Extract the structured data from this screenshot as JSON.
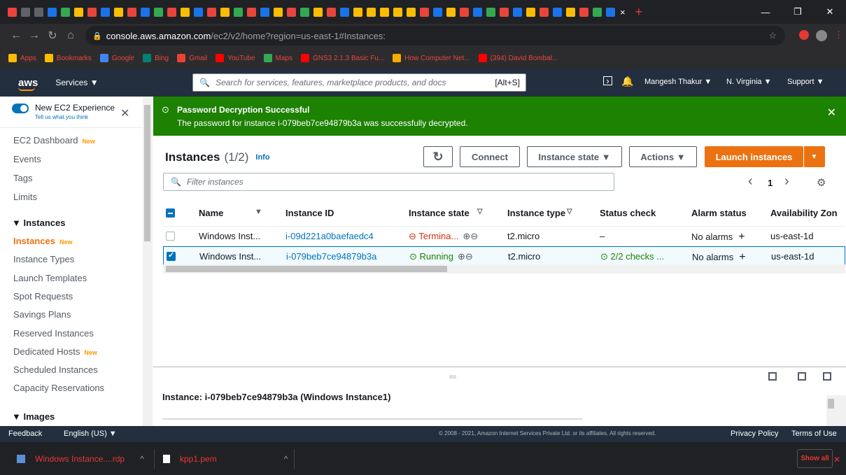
{
  "browser": {
    "tab_close": "×",
    "new_tab": "+",
    "window": {
      "minimize": "—",
      "maximize": "❐",
      "close": "✕"
    },
    "url_host": "console.aws.amazon.com",
    "url_path": "/ec2/v2/home?region=us-east-1#Instances:",
    "bookmarks": [
      {
        "label": "Apps",
        "color": "#fbbc04"
      },
      {
        "label": "Bookmarks",
        "color": "#fbbc04"
      },
      {
        "label": "Google",
        "color": "#4285f4"
      },
      {
        "label": "Bing",
        "color": "#008373"
      },
      {
        "label": "Gmail",
        "color": "#ea4335"
      },
      {
        "label": "YouTube",
        "color": "#ff0000"
      },
      {
        "label": "Maps",
        "color": "#34a853"
      },
      {
        "label": "GNS3 2.1.3 Basic Fu...",
        "color": "#ff0000"
      },
      {
        "label": "How Computer Net...",
        "color": "#f9ab00"
      },
      {
        "label": "(394) David Bombal...",
        "color": "#ff0000"
      }
    ]
  },
  "aws_nav": {
    "logo": "aws",
    "services": "Services ▼",
    "search_placeholder": "Search for services, features, marketplace products, and docs",
    "search_shortcut": "[Alt+S]",
    "user": "Mangesh Thakur ▼",
    "region": "N. Virginia ▼",
    "support": "Support ▼"
  },
  "sidebar": {
    "toggle_label": "New EC2 Experience",
    "toggle_sub": "Tell us what you think",
    "close": "✕",
    "new_badge": "New",
    "items": [
      {
        "label": "EC2 Dashboard",
        "new": true
      },
      {
        "label": "Events"
      },
      {
        "label": "Tags"
      },
      {
        "label": "Limits"
      }
    ],
    "section_instances": "▼  Instances",
    "instances_items": [
      {
        "label": "Instances",
        "new": true,
        "active": true
      },
      {
        "label": "Instance Types"
      },
      {
        "label": "Launch Templates"
      },
      {
        "label": "Spot Requests"
      },
      {
        "label": "Savings Plans"
      },
      {
        "label": "Reserved Instances"
      },
      {
        "label": "Dedicated Hosts",
        "new": true
      },
      {
        "label": "Scheduled Instances"
      },
      {
        "label": "Capacity Reservations"
      }
    ],
    "section_images": "▼  Images"
  },
  "banner": {
    "title": "Password Decryption Successful",
    "message": "The password for instance i-079beb7ce94879b3a was successfully decrypted.",
    "close": "✕"
  },
  "instances": {
    "title": "Instances",
    "count": "(1/2)",
    "info": "Info",
    "refresh": "↻",
    "connect": "Connect",
    "instance_state": "Instance state ▼",
    "actions": "Actions ▼",
    "launch": "Launch instances",
    "launch_arrow": "▼",
    "filter_placeholder": "Filter instances",
    "page_prev": "‹",
    "page": "1",
    "page_next": "›",
    "columns": [
      "Name",
      "Instance ID",
      "Instance state",
      "Instance type",
      "Status check",
      "Alarm status",
      "Availability Zon"
    ],
    "col_sort": "▼",
    "col_filter": "▽",
    "rows": [
      {
        "name": "Windows Inst...",
        "id": "i-09d221a0baefaedc4",
        "state": "Termina...",
        "state_color": "#d13212",
        "type": "t2.micro",
        "status": "–",
        "alarm": "No alarms",
        "az": "us-east-1d",
        "selected": false
      },
      {
        "name": "Windows Inst...",
        "id": "i-079beb7ce94879b3a",
        "state": "Running",
        "state_color": "#1d8102",
        "type": "t2.micro",
        "status": "2/2 checks ...",
        "alarm": "No alarms",
        "az": "us-east-1d",
        "selected": true
      }
    ],
    "zoom_glyphs": "⊕⊖",
    "alarm_plus": "+"
  },
  "detail": {
    "title": "Instance: i-079beb7ce94879b3a (Windows Instance1)",
    "handle": "═"
  },
  "footer": {
    "feedback": "Feedback",
    "language": "English (US) ▼",
    "copyright": "© 2008 - 2021, Amazon Internet Services Private Ltd. or its affiliates. All rights reserved.",
    "privacy": "Privacy Policy",
    "terms": "Terms of Use"
  },
  "downloads": {
    "items": [
      {
        "label": "Windows Instance....rdp"
      },
      {
        "label": "kpp1.pem"
      }
    ],
    "chevron": "^",
    "show_all": "Show all",
    "close": "✕"
  },
  "colors": {
    "aws_orange": "#ec7211",
    "success_green": "#1d8102",
    "link_blue": "#0073bb",
    "nav_dark": "#232f3e"
  }
}
